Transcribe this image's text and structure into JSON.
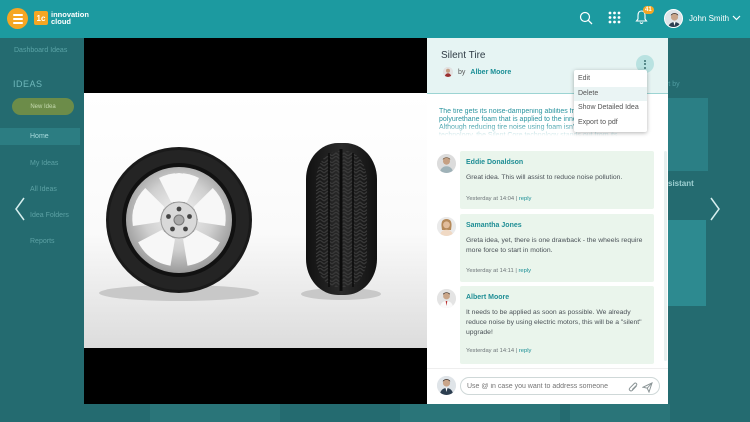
{
  "topbar": {
    "logo_badge": "1c",
    "logo_text": "innovation cloud",
    "notifications_count": "41",
    "user_name": "John Smith",
    "accent": "#1c9aa0",
    "brand_orange": "#f5a623"
  },
  "background_page": {
    "breadcrumb": "Dashboard Ideas",
    "section_title": "IDEAS",
    "new_idea_label": "New Idea",
    "nav": [
      "Home",
      "My Ideas",
      "All Ideas",
      "Idea Folders",
      "Reports"
    ],
    "right_label": "rt by",
    "card_caption": "sistant"
  },
  "idea": {
    "title": "Silent Tire",
    "by_label": "by",
    "author": "Alber Moore",
    "description": "The tire gets its noise-dampening abilities from a layer of polyurethane foam that is applied to the inner lining. Although reducing tire noise using foam isn't new technology, the Silent Core technology stands out from its"
  },
  "menu": {
    "items": [
      "Edit",
      "Delete",
      "Show Detailed Idea",
      "Export to pdf"
    ]
  },
  "comments": [
    {
      "author": "Eddie Donaldson",
      "text": "Great idea. This will assist to reduce noise pollution.",
      "time": "Yesterday at 14:04",
      "reply": "reply"
    },
    {
      "author": "Samantha Jones",
      "text": "Greta idea, yet, there is one drawback - the wheels require more force to start in motion.",
      "time": "Yesterday at 14:11",
      "reply": "reply"
    },
    {
      "author": "Albert Moore",
      "text": "It needs to be applied as soon as possible. We already reduce noise by using electric motors, this will be a \"silent\" upgrade!",
      "time": "Yesterday at 14:14",
      "reply": "reply"
    }
  ],
  "comment_input": {
    "placeholder": "Use @ in case you want to address someone"
  }
}
